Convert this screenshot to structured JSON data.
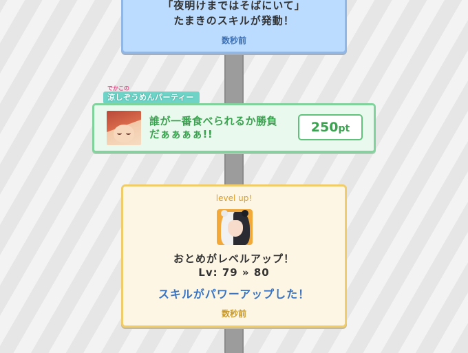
{
  "skill_card": {
    "quote": "「夜明けまではそばにいて」",
    "message": "たまきのスキルが発動！",
    "time": "数秒前"
  },
  "event": {
    "tag_small": "でかこの",
    "tag_label": "涼しぞうめんパーティー",
    "text_line1": "誰が一番食べられるか勝負",
    "text_line2": "だぁぁぁぁ!!",
    "points_value": "250",
    "points_unit": "pt"
  },
  "level_card": {
    "title": "level up!",
    "name": "おとめがレベルアップ！",
    "level_text": "Lv: 79 » 80",
    "power_text": "スキルがパワーアップした！",
    "time": "数秒前"
  },
  "colors": {
    "skill_bg": "#bcdcff",
    "event_accent": "#3aa34f",
    "level_border": "#f0cc6a",
    "power_text": "#3a74c0"
  }
}
